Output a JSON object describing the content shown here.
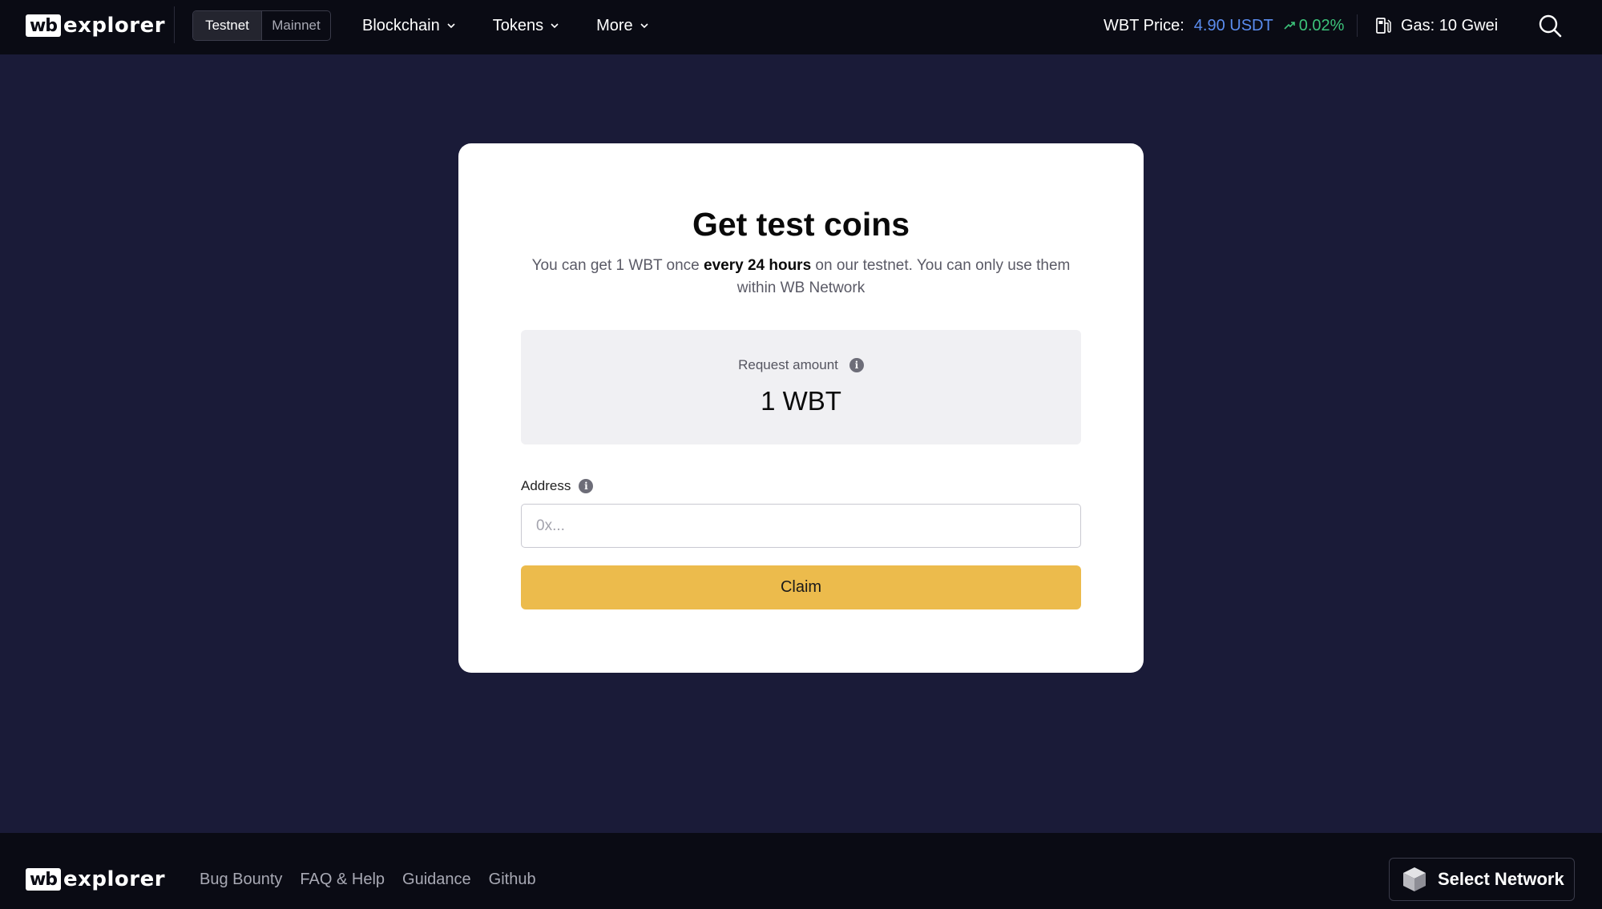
{
  "header": {
    "logo_mark": "wb",
    "logo_text": "explorer",
    "network_options": [
      "Testnet",
      "Mainnet"
    ],
    "active_network": "Testnet",
    "nav": [
      {
        "label": "Blockchain"
      },
      {
        "label": "Tokens"
      },
      {
        "label": "More"
      }
    ],
    "price_label": "WBT Price:",
    "price_value": "4.90 USDT",
    "price_change": "0.02%",
    "gas": "Gas: 10 Gwei",
    "colors": {
      "price_value": "#5b8def",
      "price_change": "#3cc37a"
    }
  },
  "card": {
    "title": "Get test coins",
    "desc_pre": "You can get 1 WBT once ",
    "desc_bold": "every 24 hours",
    "desc_post": " on our testnet. You can only use them within WB Network",
    "amount_label": "Request amount",
    "amount_value": "1 WBT",
    "address_label": "Address",
    "address_placeholder": "0x...",
    "address_value": "",
    "claim_label": "Claim",
    "colors": {
      "claim_button": "#ecbb4c"
    }
  },
  "footer": {
    "logo_mark": "wb",
    "logo_text": "explorer",
    "links": [
      "Bug Bounty",
      "FAQ & Help",
      "Guidance",
      "Github"
    ],
    "select_network_label": "Select Network"
  },
  "icons": [
    "chevron-down-icon",
    "trend-up-icon",
    "gas-pump-icon",
    "search-icon",
    "info-icon",
    "cube-icon"
  ]
}
